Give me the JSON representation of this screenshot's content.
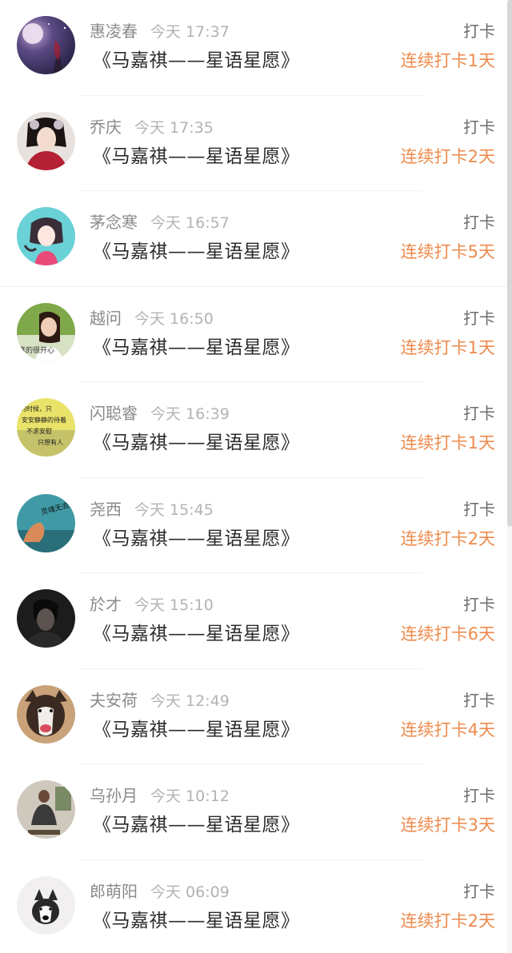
{
  "entries": [
    {
      "name": "惠凌春",
      "time": "今天 17:37",
      "title": "《马嘉祺——星语星愿》",
      "action": "打卡",
      "streak": "连续打卡1天",
      "avatar": "avatar-night-sky"
    },
    {
      "name": "乔庆",
      "time": "今天 17:35",
      "title": "《马嘉祺——星语星愿》",
      "action": "打卡",
      "streak": "连续打卡2天",
      "avatar": "avatar-costume-girl"
    },
    {
      "name": "茅念寒",
      "time": "今天 16:57",
      "title": "《马嘉祺——星语星愿》",
      "action": "打卡",
      "streak": "连续打卡5天",
      "avatar": "avatar-anime-girl"
    },
    {
      "name": "越问",
      "time": "今天 16:50",
      "title": "《马嘉祺——星语星愿》",
      "action": "打卡",
      "streak": "连续打卡1天",
      "avatar": "avatar-smiling-woman"
    },
    {
      "name": "闪聪睿",
      "time": "今天 16:39",
      "title": "《马嘉祺——星语星愿》",
      "action": "打卡",
      "streak": "连续打卡1天",
      "avatar": "avatar-text-image"
    },
    {
      "name": "尧西",
      "time": "今天 15:45",
      "title": "《马嘉祺——星语星愿》",
      "action": "打卡",
      "streak": "连续打卡2天",
      "avatar": "avatar-hand-teal"
    },
    {
      "name": "於才",
      "time": "今天 15:10",
      "title": "《马嘉祺——星语星愿》",
      "action": "打卡",
      "streak": "连续打卡6天",
      "avatar": "avatar-dark-portrait"
    },
    {
      "name": "夫安荷",
      "time": "今天 12:49",
      "title": "《马嘉祺——星语星愿》",
      "action": "打卡",
      "streak": "连续打卡4天",
      "avatar": "avatar-husky-dog"
    },
    {
      "name": "乌孙月",
      "time": "今天 10:12",
      "title": "《马嘉祺——星语星愿》",
      "action": "打卡",
      "streak": "连续打卡3天",
      "avatar": "avatar-sitting-man"
    },
    {
      "name": "郎萌阳",
      "time": "今天 06:09",
      "title": "《马嘉祺——星语星愿》",
      "action": "打卡",
      "streak": "连续打卡2天",
      "avatar": "avatar-husky-puppy"
    }
  ],
  "avatar_text": {
    "smiling_woman": "真的很开心",
    "text_image": [
      "的时候，只",
      "安安静静的待着",
      "不求安慰",
      "只想有人"
    ],
    "hand_teal": "灵魂无去处"
  },
  "colors": {
    "streak": "#ee8a4c",
    "name": "#8a8a8a",
    "time": "#b3b3b3",
    "title": "#2b2b2b",
    "action": "#6d6d6d"
  }
}
